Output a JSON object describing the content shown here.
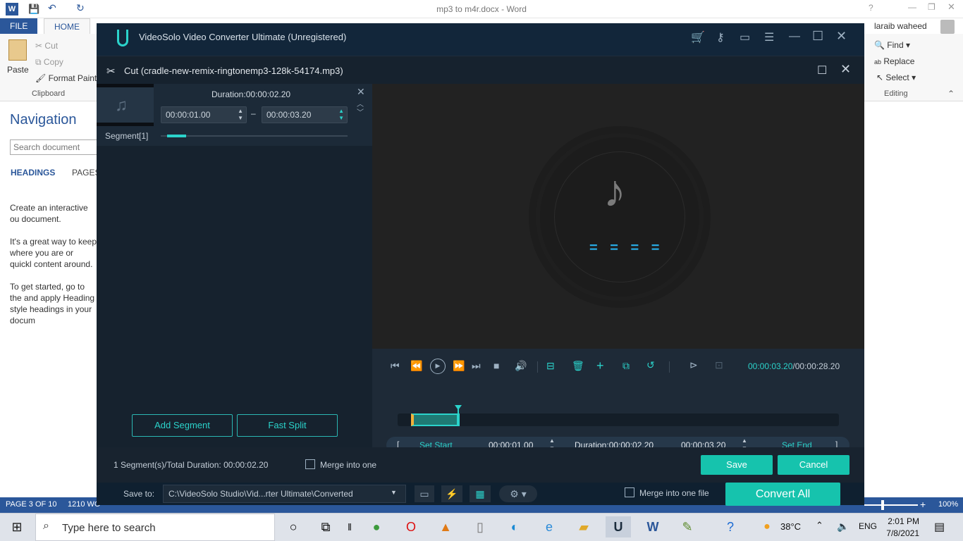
{
  "word": {
    "title": "mp3 to m4r.docx - Word",
    "tab_file": "FILE",
    "tab_home": "HOME",
    "user": "laraib waheed",
    "clipboard": {
      "paste": "Paste",
      "cut": "Cut",
      "copy": "Copy",
      "format_painter": "Format Paint",
      "group": "Clipboard"
    },
    "editing": {
      "find": "Find",
      "replace": "Replace",
      "select": "Select",
      "group": "Editing"
    },
    "nav": {
      "title": "Navigation",
      "search_placeholder": "Search document",
      "tab_headings": "HEADINGS",
      "tab_pages": "PAGES",
      "p1": "Create an interactive ou document.",
      "p2": "It's a great way to keep where you are or quickl content around.",
      "p3": "To get started, go to the and apply Heading style headings in your docum"
    },
    "status": {
      "page": "PAGE 3 OF 10",
      "words": "1210 WO",
      "zoom": "100%"
    }
  },
  "app": {
    "title": "VideoSolo Video Converter Ultimate (Unregistered)",
    "cut_title": "Cut (cradle-new-remix-ringtonemp3-128k-54174.mp3)",
    "segment": {
      "label": "Segment[1]",
      "duration": "Duration:00:00:02.20",
      "start": "00:00:01.00",
      "end": "00:00:03.20",
      "progress": 0.1
    },
    "buttons": {
      "add_segment": "Add Segment",
      "fast_split": "Fast Split",
      "save": "Save",
      "cancel": "Cancel",
      "convert_all": "Convert All"
    },
    "player": {
      "current": "00:00:03.20",
      "total": "/00:00:28.20",
      "selection_start_frac": 0.03,
      "selection_end_frac": 0.14,
      "playhead_frac": 0.135
    },
    "range": {
      "open_bracket": "[",
      "set_start": "Set Start",
      "start": "00:00:01.00",
      "duration": "Duration:00:00:02.20",
      "end": "00:00:03.20",
      "set_end": "Set End",
      "close_bracket": "]"
    },
    "footer": {
      "summary": "1 Segment(s)/Total Duration: 00:00:02.20",
      "merge_label": "Merge into one"
    },
    "savebar": {
      "save_to": "Save to:",
      "path": "C:\\VideoSolo Studio\\Vid...rter Ultimate\\Converted",
      "merge_file": "Merge into one file"
    },
    "accent": "#16c3ad"
  },
  "taskbar": {
    "search_placeholder": "Type here to search",
    "temp": "38°C",
    "lang": "ENG",
    "time": "2:01 PM",
    "date": "7/8/2021"
  }
}
